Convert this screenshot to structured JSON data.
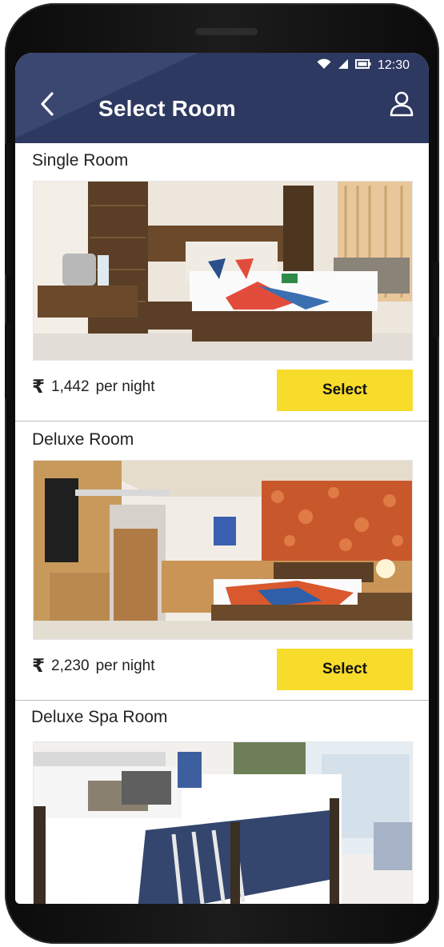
{
  "status_bar": {
    "time": "12:30"
  },
  "header": {
    "title": "Select Room"
  },
  "rooms": [
    {
      "name": "Single Room",
      "currency_symbol": "₹",
      "price": "1,442",
      "price_unit": "per night",
      "button_label": "Select"
    },
    {
      "name": "Deluxe Room",
      "currency_symbol": "₹",
      "price": "2,230",
      "price_unit": "per night",
      "button_label": "Select"
    },
    {
      "name": "Deluxe Spa Room"
    }
  ],
  "colors": {
    "appbar": "#2e3961",
    "appbar_highlight": "#3b4771",
    "select_button": "#f8dc2c",
    "text": "#222222"
  },
  "icons": [
    "wifi-icon",
    "cellular-signal-icon",
    "battery-icon",
    "back-arrow-icon",
    "profile-icon"
  ]
}
